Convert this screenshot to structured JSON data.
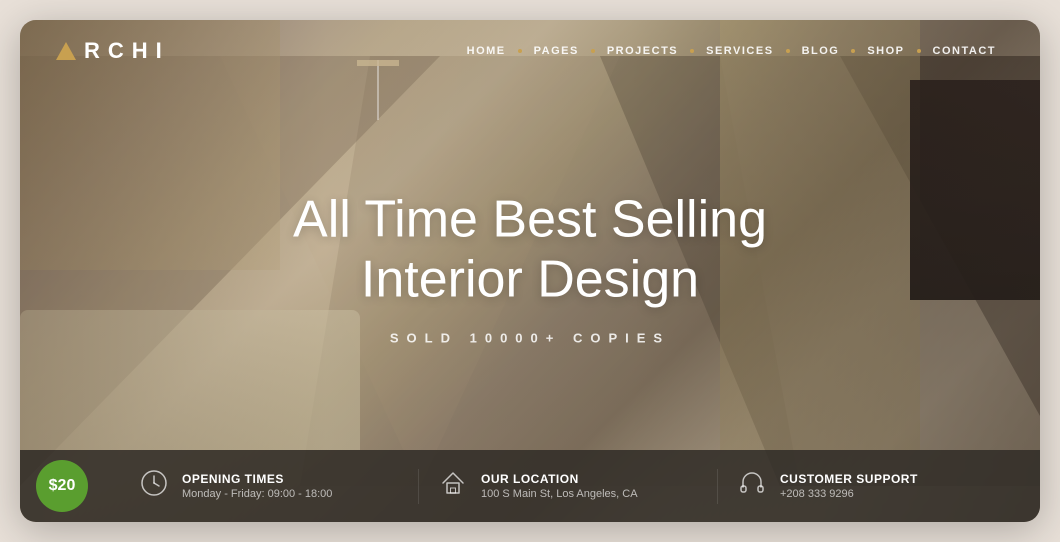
{
  "brand": {
    "name": "RCHI",
    "logo_letter": "A"
  },
  "nav": {
    "items": [
      {
        "label": "HOME",
        "id": "home"
      },
      {
        "label": "PAGES",
        "id": "pages"
      },
      {
        "label": "PROJECTS",
        "id": "projects"
      },
      {
        "label": "SERVICES",
        "id": "services"
      },
      {
        "label": "BLOG",
        "id": "blog"
      },
      {
        "label": "SHOP",
        "id": "shop"
      },
      {
        "label": "CONTACT",
        "id": "contact"
      }
    ]
  },
  "hero": {
    "title_line1": "All Time Best Selling",
    "title_line2": "Interior Design",
    "subtitle": "SOLD 10000+ COPIES"
  },
  "bottom_bar": {
    "price": "$20",
    "info_items": [
      {
        "id": "opening",
        "label": "OPENING TIMES",
        "value": "Monday - Friday: 09:00 - 18:00"
      },
      {
        "id": "location",
        "label": "OUR LOCATION",
        "value": "100 S Main St, Los Angeles, CA"
      },
      {
        "id": "support",
        "label": "CUSTOMER SUPPORT",
        "value": "+208 333 9296"
      }
    ]
  }
}
